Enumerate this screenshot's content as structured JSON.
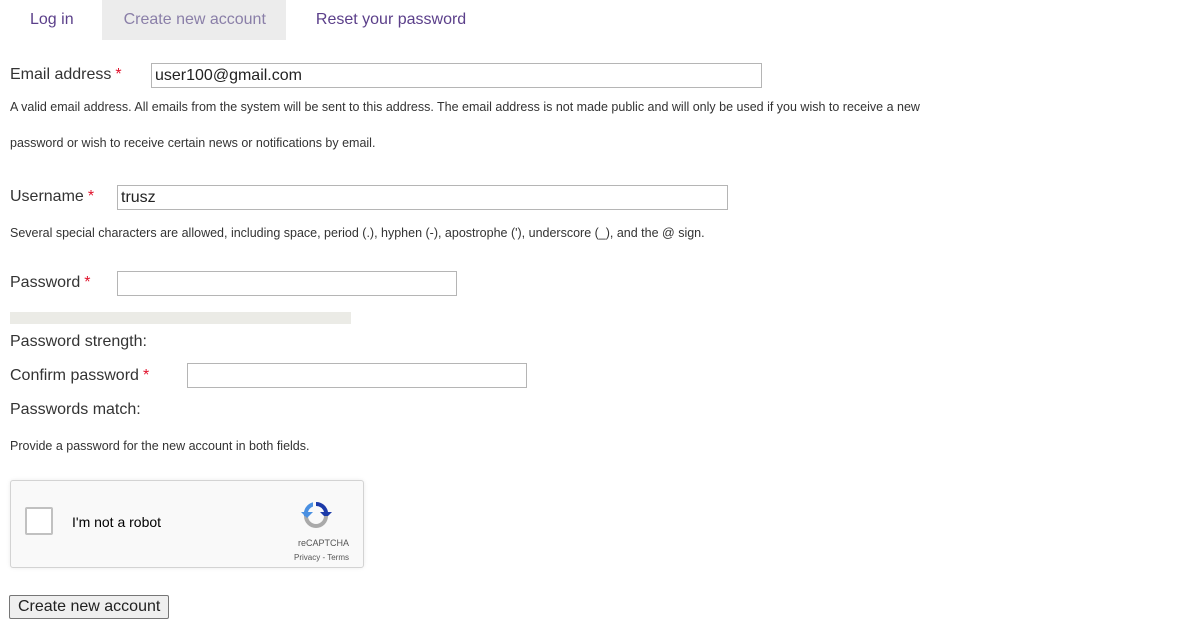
{
  "tabs": [
    {
      "label": "Log in"
    },
    {
      "label": "Create new account",
      "active": true
    },
    {
      "label": "Reset your password"
    }
  ],
  "form": {
    "email": {
      "label": "Email address",
      "required_mark": "*",
      "value": "user100@gmail.com",
      "description_line1": "A valid email address. All emails from the system will be sent to this address. The email address is not made public and will only be used if you wish to receive a new",
      "description_line2": "password or wish to receive certain news or notifications by email."
    },
    "username": {
      "label": "Username",
      "required_mark": "*",
      "value": "trusz",
      "description": "Several special characters are allowed, including space, period (.), hyphen (-), apostrophe ('), underscore (_), and the @ sign."
    },
    "password": {
      "label": "Password",
      "required_mark": "*",
      "value": "",
      "strength_label": "Password strength:",
      "strength_fraction": 0
    },
    "confirm_password": {
      "label": "Confirm password",
      "required_mark": "*",
      "value": "",
      "match_label": "Passwords match:"
    },
    "password_description": "Provide a password for the new account in both fields."
  },
  "recaptcha": {
    "checkbox_label": "I'm not a robot",
    "checked": false,
    "brand": "reCAPTCHA",
    "links": "Privacy - Terms",
    "logo_icon": "recaptcha-logo-icon"
  },
  "submit_label": "Create new account",
  "colors": {
    "link": "#5b3f8a",
    "active_tab_bg": "#ececec",
    "required": "#e0112b"
  }
}
